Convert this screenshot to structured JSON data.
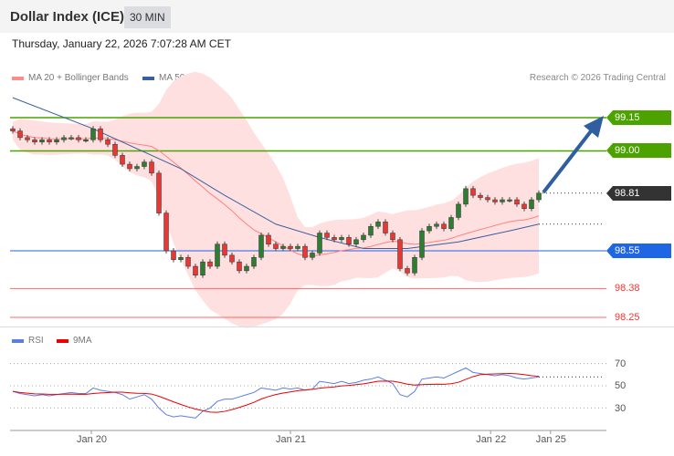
{
  "header": {
    "title": "Dollar Index (ICE)",
    "timeframe": "30 MIN"
  },
  "timestamp": "Thursday, January 22, 2026 7:07:28 AM CET",
  "legend": {
    "ma20": "MA 20 + Bollinger Bands",
    "ma50": "MA 50",
    "rsi": "RSI",
    "rsi_ma": "9MA"
  },
  "credit": "Research © 2026 Trading Central",
  "colors": {
    "up": "#2e7d32",
    "down": "#e53935",
    "resistance": "#4ca300",
    "pivot": "#1f66e5",
    "support": "#ff6666",
    "last": "#333333",
    "arrow": "#2f5f9e",
    "band": "#ffe0e0",
    "ma50": "#3a5fa0"
  },
  "levels": {
    "r2": "99.15",
    "r1": "99.00",
    "last": "98.81",
    "pivot": "98.55",
    "s1": "98.38",
    "s2": "98.25"
  },
  "chart_data": {
    "type": "candlestick",
    "title": "Dollar Index (ICE) 30 MIN",
    "ylim": [
      98.2,
      99.25
    ],
    "closes": [
      99.09,
      99.06,
      99.05,
      99.04,
      99.05,
      99.04,
      99.05,
      99.06,
      99.06,
      99.05,
      99.05,
      99.1,
      99.05,
      99.03,
      98.98,
      98.94,
      98.92,
      98.93,
      98.95,
      98.9,
      98.72,
      98.55,
      98.51,
      98.52,
      98.48,
      98.44,
      98.5,
      98.48,
      98.58,
      98.53,
      98.5,
      98.46,
      98.48,
      98.52,
      98.62,
      98.58,
      98.56,
      98.57,
      98.56,
      98.57,
      98.52,
      98.54,
      98.63,
      98.61,
      98.6,
      98.61,
      98.58,
      98.6,
      98.62,
      98.66,
      98.68,
      98.63,
      98.6,
      98.47,
      98.45,
      98.52,
      98.64,
      98.66,
      98.67,
      98.65,
      98.7,
      98.76,
      98.83,
      98.8,
      98.79,
      98.78,
      98.77,
      98.78,
      98.78,
      98.76,
      98.74,
      98.78,
      98.81
    ],
    "ma50_points": [
      [
        0,
        99.24
      ],
      [
        11,
        99.1
      ],
      [
        23,
        98.92
      ],
      [
        29,
        98.8
      ],
      [
        36,
        98.67
      ],
      [
        42,
        98.61
      ],
      [
        48,
        98.56
      ],
      [
        54,
        98.56
      ],
      [
        61,
        98.59
      ],
      [
        68,
        98.64
      ],
      [
        72,
        98.67
      ]
    ],
    "rsi": [
      45,
      43,
      42,
      41,
      42,
      41,
      42,
      43,
      44,
      43,
      43,
      48,
      46,
      45,
      44,
      42,
      38,
      40,
      42,
      38,
      30,
      24,
      22,
      23,
      22,
      21,
      27,
      30,
      36,
      38,
      38,
      40,
      42,
      44,
      48,
      47,
      46,
      48,
      47,
      48,
      46,
      47,
      54,
      53,
      52,
      54,
      52,
      53,
      55,
      56,
      58,
      55,
      52,
      42,
      40,
      45,
      56,
      57,
      58,
      57,
      60,
      63,
      66,
      62,
      61,
      60,
      59,
      60,
      59,
      57,
      56,
      57,
      58
    ],
    "rsi_levels": [
      70,
      50,
      30
    ],
    "rsi_ylim": [
      10,
      85
    ],
    "x_ticks": [
      {
        "label": "Jan 20",
        "index": 10.75
      },
      {
        "label": "Jan 21",
        "index": 38
      },
      {
        "label": "Jan 22",
        "index": 65.4
      },
      {
        "label": "Jan 25",
        "index": 73.6
      }
    ],
    "forecast_target": 99.15
  }
}
